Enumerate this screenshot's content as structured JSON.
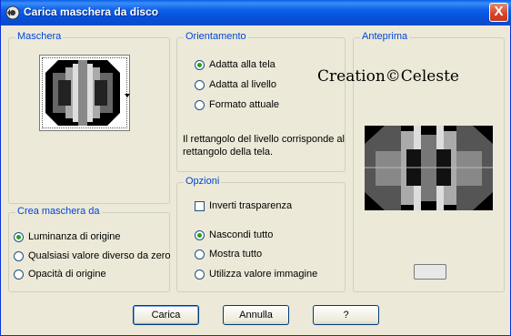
{
  "window": {
    "title": "Carica maschera da disco",
    "close_glyph": "X"
  },
  "mask_group": {
    "title": "Maschera"
  },
  "source_group": {
    "title": "Crea maschera da",
    "options": [
      {
        "label": "Luminanza di origine",
        "selected": true
      },
      {
        "label": "Qualsiasi valore diverso da zero",
        "selected": false
      },
      {
        "label": "Opacità di origine",
        "selected": false
      }
    ]
  },
  "orientation_group": {
    "title": "Orientamento",
    "options": [
      {
        "label": "Adatta alla tela",
        "selected": true
      },
      {
        "label": "Adatta al livello",
        "selected": false
      },
      {
        "label": "Formato attuale",
        "selected": false
      }
    ],
    "description_line1": "Il rettangolo del livello corrisponde al",
    "description_line2": "rettangolo della tela."
  },
  "options_group": {
    "title": "Opzioni",
    "invert_label": "Inverti trasparenza",
    "invert_checked": false,
    "options": [
      {
        "label": "Nascondi tutto",
        "selected": true
      },
      {
        "label": "Mostra tutto",
        "selected": false
      },
      {
        "label": "Utilizza valore immagine",
        "selected": false
      }
    ]
  },
  "preview_group": {
    "title": "Anteprima"
  },
  "watermark": "Creation©Celeste",
  "buttons": {
    "load": "Carica",
    "cancel": "Annulla",
    "help": "?"
  },
  "colors": {
    "group_title": "#0046d5",
    "titlebar": "#0a5fe8",
    "radio_selected": "#21a121"
  }
}
